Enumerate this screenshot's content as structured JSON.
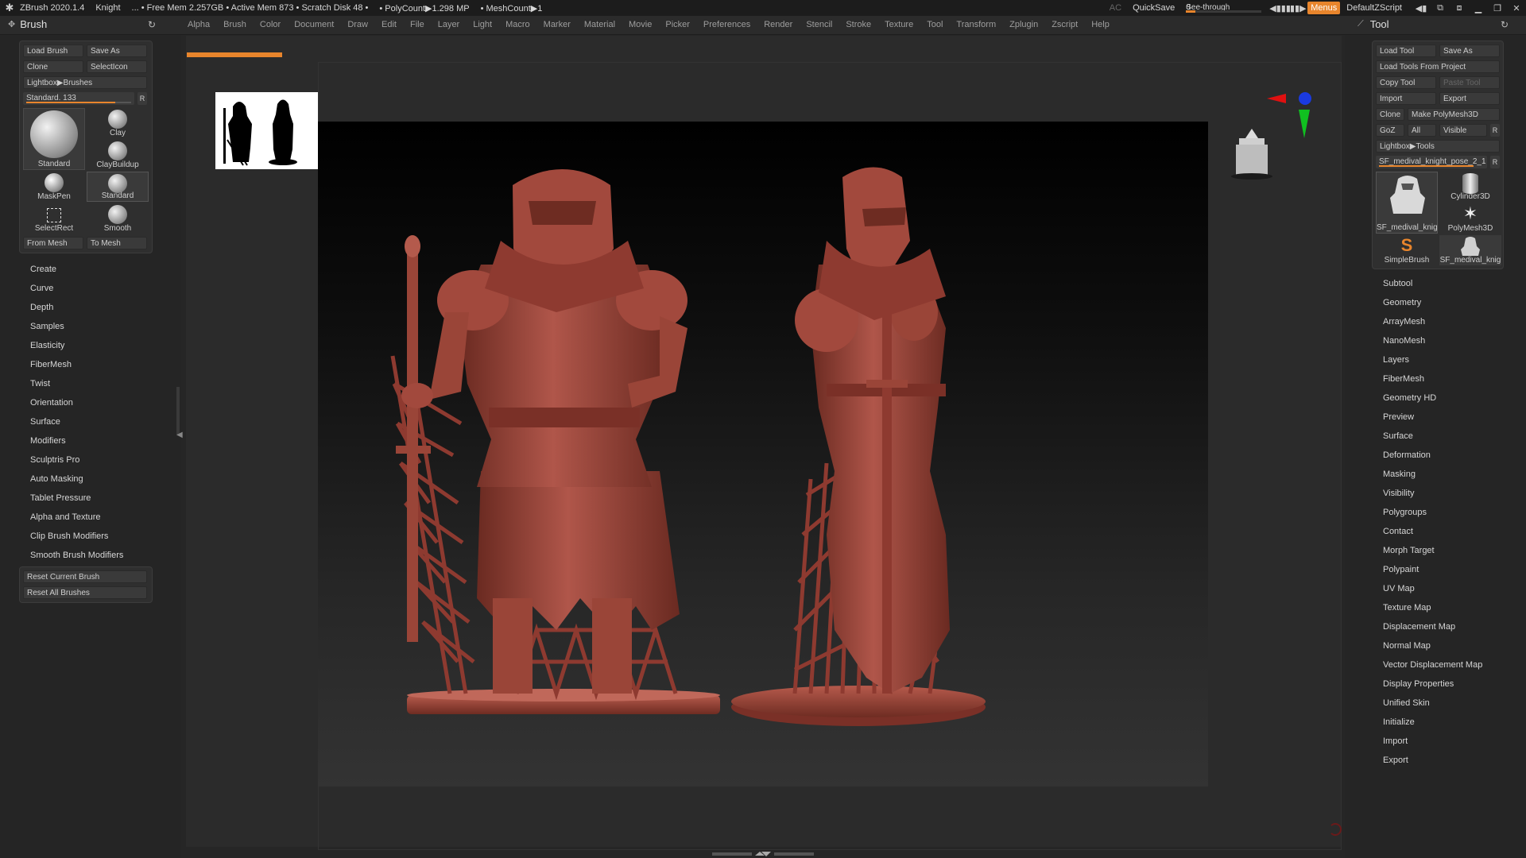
{
  "titlebar": {
    "app": "ZBrush 2020.1.4",
    "project": "Knight",
    "stats": "... • Free Mem 2.257GB • Active Mem 873 • Scratch Disk 48 •",
    "polycount": "• PolyCount▶1.298 MP",
    "meshcount": "• MeshCount▶1",
    "ac": "AC",
    "quicksave": "QuickSave",
    "seethrough_label": "See-through",
    "seethrough_value": "0",
    "seethrough_level": 0.12,
    "menus": "Menus",
    "default_zscript": "DefaultZScript"
  },
  "menubar": {
    "brush_title": "Brush",
    "tool_title": "Tool",
    "items": [
      "Alpha",
      "Brush",
      "Color",
      "Document",
      "Draw",
      "Edit",
      "File",
      "Layer",
      "Light",
      "Macro",
      "Marker",
      "Material",
      "Movie",
      "Picker",
      "Preferences",
      "Render",
      "Stencil",
      "Stroke",
      "Texture",
      "Tool",
      "Transform",
      "Zplugin",
      "Zscript",
      "Help"
    ]
  },
  "brush_panel": {
    "load_brush": "Load Brush",
    "save_as": "Save As",
    "clone": "Clone",
    "select_icon": "SelectIcon",
    "lightbox": "Lightbox▶Brushes",
    "slider_label": "Standard.",
    "slider_value": "133",
    "slider_level": 0.85,
    "r": "R",
    "thumbs": {
      "standard_big": "Standard",
      "clay": "Clay",
      "claybuildup": "ClayBuildup",
      "maskpen": "MaskPen",
      "standard": "Standard",
      "selectrect": "SelectRect",
      "smooth": "Smooth"
    },
    "from_mesh": "From Mesh",
    "to_mesh": "To Mesh",
    "menu": [
      "Create",
      "Curve",
      "Depth",
      "Samples",
      "Elasticity",
      "FiberMesh",
      "Twist",
      "Orientation",
      "Surface",
      "Modifiers",
      "Sculptris Pro",
      "Auto Masking",
      "Tablet Pressure",
      "Alpha and Texture",
      "Clip Brush Modifiers",
      "Smooth Brush Modifiers"
    ],
    "reset_current": "Reset Current Brush",
    "reset_all": "Reset All Brushes"
  },
  "tool_panel": {
    "load_tool": "Load Tool",
    "save_as": "Save As",
    "load_from_project": "Load Tools From Project",
    "copy_tool": "Copy Tool",
    "paste_tool": "Paste Tool",
    "import": "Import",
    "export": "Export",
    "clone": "Clone",
    "make_polymesh": "Make PolyMesh3D",
    "goz": "GoZ",
    "all": "All",
    "visible": "Visible",
    "r": "R",
    "lightbox": "Lightbox▶Tools",
    "slider_label": "SF_medival_knight_pose_2_1",
    "slider_level": 0.9,
    "thumbs": {
      "knight_big": "SF_medival_knig",
      "cylinder": "Cylinder3D",
      "polymesh": "PolyMesh3D",
      "simplebrush": "SimpleBrush",
      "knight_small": "SF_medival_knig"
    },
    "menu": [
      "Subtool",
      "Geometry",
      "ArrayMesh",
      "NanoMesh",
      "Layers",
      "FiberMesh",
      "Geometry HD",
      "Preview",
      "Surface",
      "Deformation",
      "Masking",
      "Visibility",
      "Polygroups",
      "Contact",
      "Morph Target",
      "Polypaint",
      "UV Map",
      "Texture Map",
      "Displacement Map",
      "Normal Map",
      "Vector Displacement Map",
      "Display Properties",
      "Unified Skin",
      "Initialize",
      "Import",
      "Export"
    ]
  },
  "colors": {
    "accent": "#e8852c",
    "model": "#a84c3f",
    "model_shadow": "#5e241c",
    "model_highlight": "#c46a5a"
  }
}
